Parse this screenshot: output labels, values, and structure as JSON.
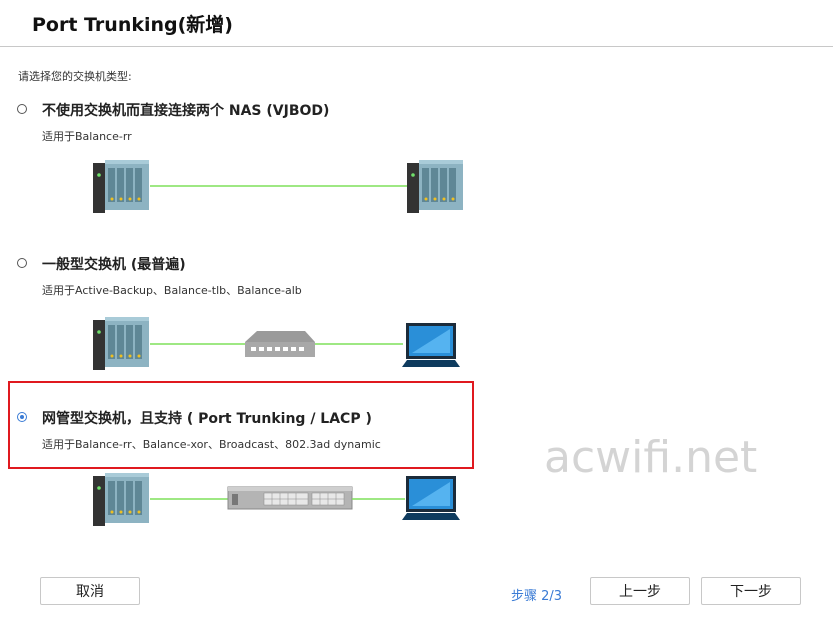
{
  "dialog": {
    "title": "Port Trunking(新增)",
    "close_glyph": "⌃"
  },
  "prompt": "请选择您的交换机类型:",
  "options": [
    {
      "label": "不使用交换机而直接连接两个 NAS (VJBOD)",
      "sub": "适用于Balance-rr",
      "selected": false
    },
    {
      "label": "一般型交换机 (最普遍)",
      "sub": "适用于Active-Backup、Balance-tlb、Balance-alb",
      "selected": false
    },
    {
      "label": "网管型交换机，且支持 ( Port Trunking / LACP )",
      "sub": "适用于Balance-rr、Balance-xor、Broadcast、802.3ad dynamic",
      "selected": true
    }
  ],
  "colors": {
    "accent": "#3a7bd5",
    "highlight_border": "#e0191f",
    "link_line": "#7ee05a",
    "nas_body": "#7fa6b5",
    "laptop_screen": "#2a8fd8"
  },
  "watermark": "acwifi.net",
  "footer": {
    "cancel_label": "取消",
    "step_text": "步骤 2/3",
    "prev_label": "上一步",
    "next_label": "下一步"
  }
}
